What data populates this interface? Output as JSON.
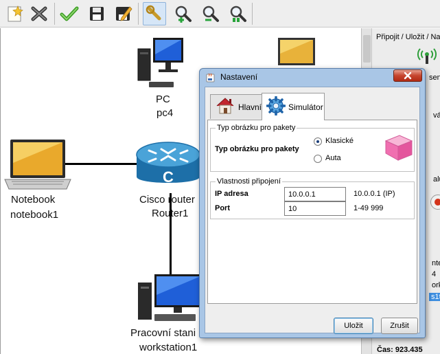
{
  "toolbar": {
    "buttons": [
      {
        "name": "new-icon"
      },
      {
        "name": "delete-icon"
      },
      {
        "name": "check-icon"
      },
      {
        "name": "save-icon"
      },
      {
        "name": "save-as-icon"
      },
      {
        "name": "link-tool-icon",
        "active": true
      },
      {
        "name": "zoom-in-icon"
      },
      {
        "name": "zoom-out-icon"
      },
      {
        "name": "zoom-reset-icon"
      }
    ]
  },
  "devices": {
    "pc": {
      "type": "PC",
      "name": "pc4"
    },
    "router": {
      "type": "Cisco router",
      "name": "Router1"
    },
    "notebook": {
      "type": "Notebook",
      "name": "notebook1"
    },
    "workstation": {
      "type": "Pracovní stani",
      "name": "workstation1"
    }
  },
  "right_panel": {
    "header": "Připojit / Uložit / Na",
    "fragment_1": "sen",
    "fragment_2": "vá",
    "fragment_3": "alu",
    "fragment_4": "nteb",
    "fragment_5": "4",
    "fragment_6": "orks",
    "fragment_7": "s1td",
    "time": "Čas: 923.435"
  },
  "dialog": {
    "title": "Nastavení",
    "close_icon": "close-icon",
    "tabs": [
      {
        "label": "Hlavní",
        "icon": "house-icon"
      },
      {
        "label": "Simulátor",
        "icon": "gear-icon",
        "active": true
      }
    ],
    "packet_group": {
      "title": "Typ obrázku pro pakety",
      "label": "Typ obrázku pro pakety",
      "options": [
        {
          "label": "Klasické",
          "selected": true
        },
        {
          "label": "Auta",
          "selected": false
        }
      ]
    },
    "connection_group": {
      "title": "Vlastnosti připojení",
      "ip_label": "IP adresa",
      "ip_value": "10.0.0.1",
      "ip_hint": "10.0.0.1 (IP)",
      "port_label": "Port",
      "port_value": "10",
      "port_hint": "1-49 999"
    },
    "save_label": "Uložit",
    "cancel_label": "Zrušit"
  },
  "colors": {
    "dialog_frame": "#a9c6e6",
    "router_blue": "#1d7cb6",
    "close_red": "#c6452e",
    "packet_pink": "#f06fb0"
  }
}
